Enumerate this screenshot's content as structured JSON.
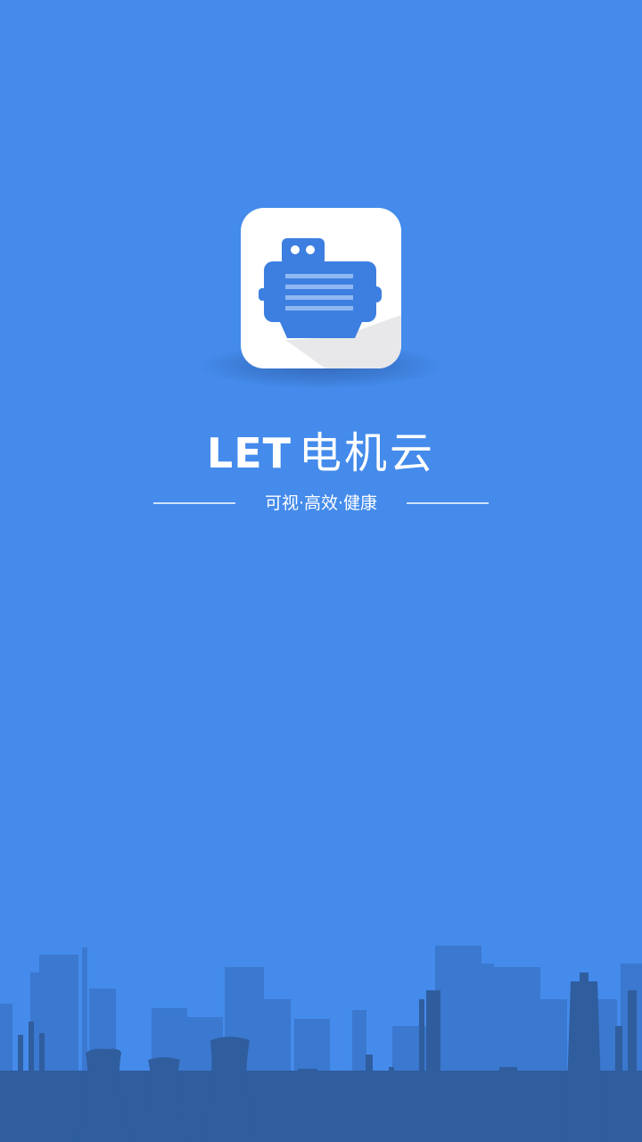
{
  "app": {
    "title_latin": "LET",
    "title_cjk": "电机云",
    "tagline": "可视·高效·健康"
  },
  "icons": {
    "logo": "electric-motor-icon",
    "background": "industrial-skyline"
  },
  "colors": {
    "background": "#448beb",
    "logo_blue": "#3d7fe0",
    "skyline_far": "#3b78cf",
    "skyline_near": "#2f5d9e"
  }
}
